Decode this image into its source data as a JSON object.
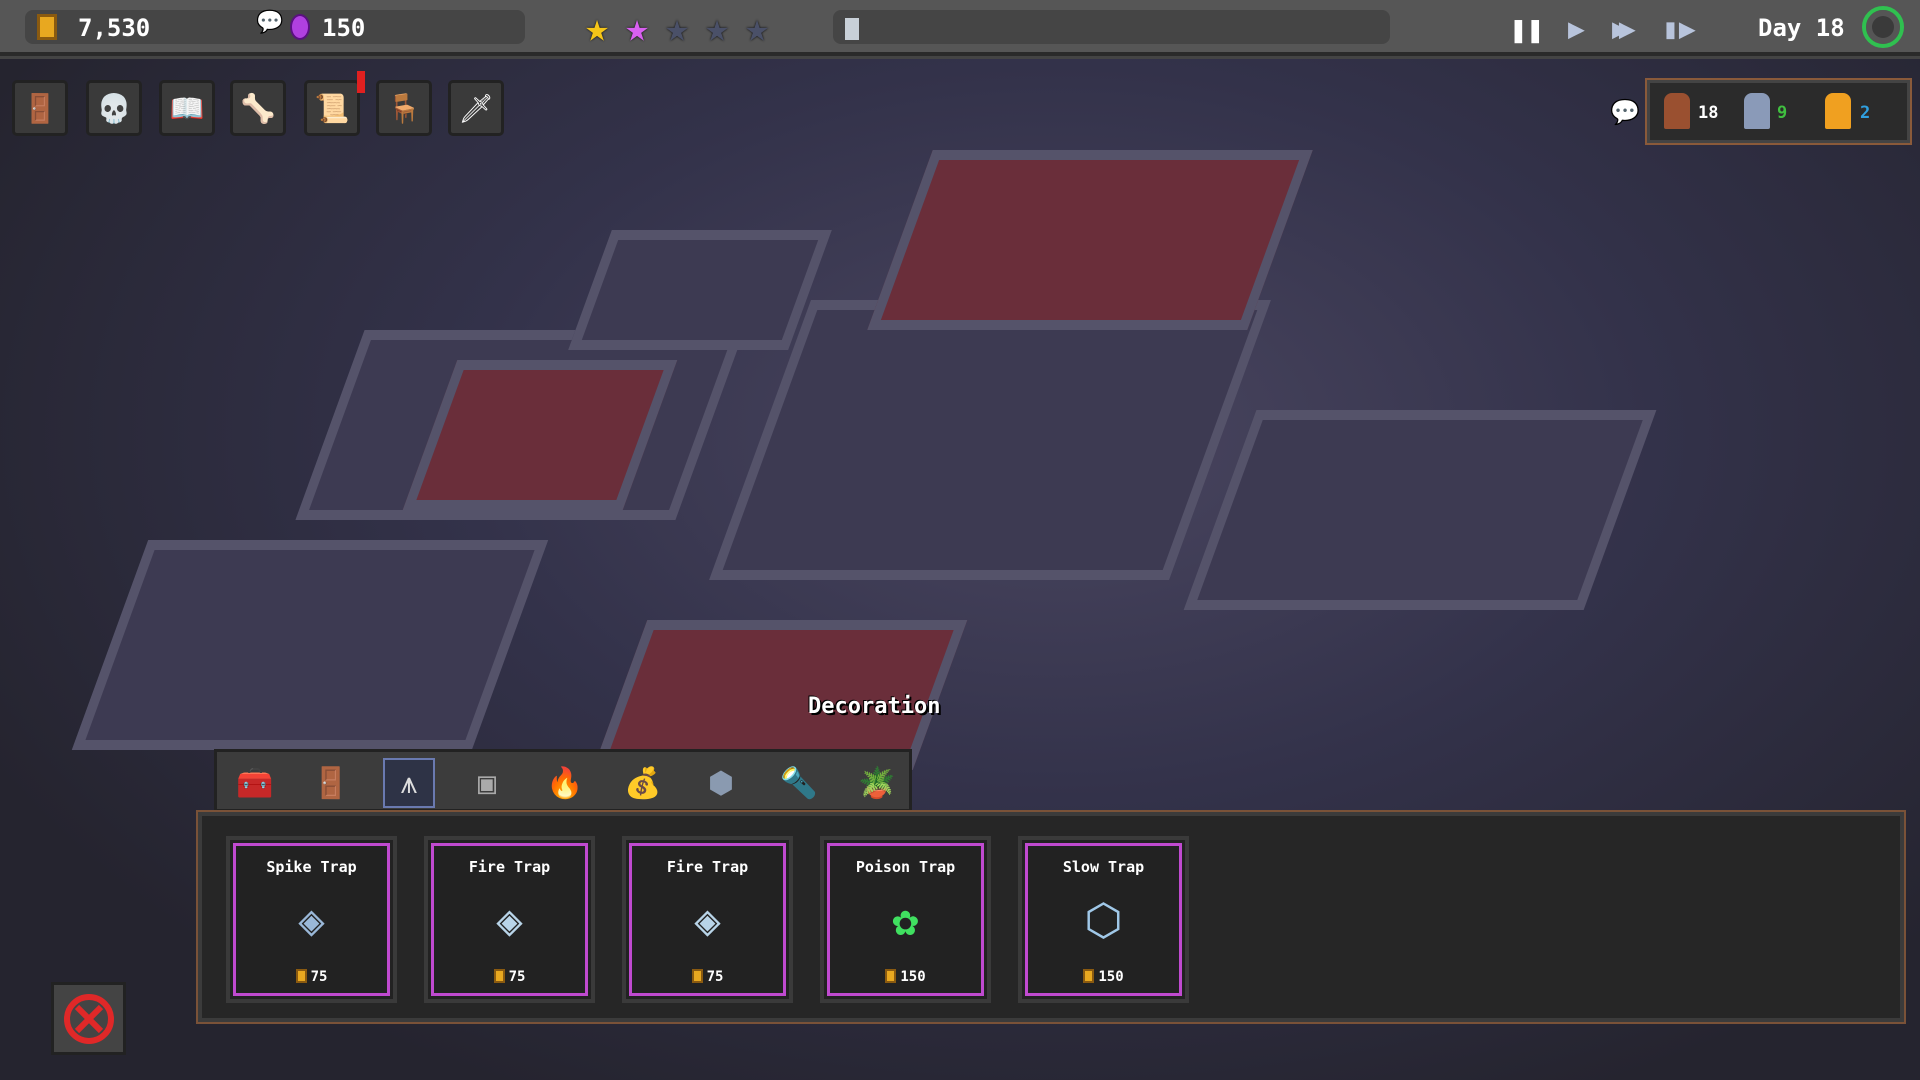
{
  "hud": {
    "gold": "7,530",
    "gems": "150",
    "stars_filled": 2,
    "stars_total": 5,
    "day": "Day 18",
    "speed_controls": [
      "pause",
      "play",
      "fast-forward",
      "skip"
    ]
  },
  "toolbar": {
    "icons": [
      "portal-icon",
      "skull-icon",
      "spellbook-icon",
      "creatures-icon",
      "quest-scroll-icon",
      "throne-icon",
      "hero-icon"
    ],
    "quest_alert": true
  },
  "population": {
    "workers": "18",
    "guards": "9",
    "special": "2"
  },
  "world_label": "Decoration",
  "categories": {
    "selected": 2,
    "icons": [
      "chest-icon",
      "door-icon",
      "trap-icon",
      "slab-icon",
      "campfire-icon",
      "sack-icon",
      "pillar-icon",
      "torch-icon",
      "plant-icon"
    ]
  },
  "items": [
    {
      "name": "Spike Trap",
      "cost": "75",
      "icon": "spike-trap-icon"
    },
    {
      "name": "Fire Trap",
      "cost": "75",
      "icon": "fire-trap-icon"
    },
    {
      "name": "Fire Trap",
      "cost": "75",
      "icon": "fire-trap-icon"
    },
    {
      "name": "Poison Trap",
      "cost": "150",
      "icon": "poison-trap-icon"
    },
    {
      "name": "Slow Trap",
      "cost": "150",
      "icon": "slow-trap-icon"
    }
  ],
  "colors": {
    "gold": "#e8a820",
    "gem": "#b040e0",
    "star_filled": "#f5c518",
    "star_pink": "#d860f0",
    "card_frame": "#c04ad0",
    "guards": "#40c040",
    "special": "#30a0e0"
  }
}
